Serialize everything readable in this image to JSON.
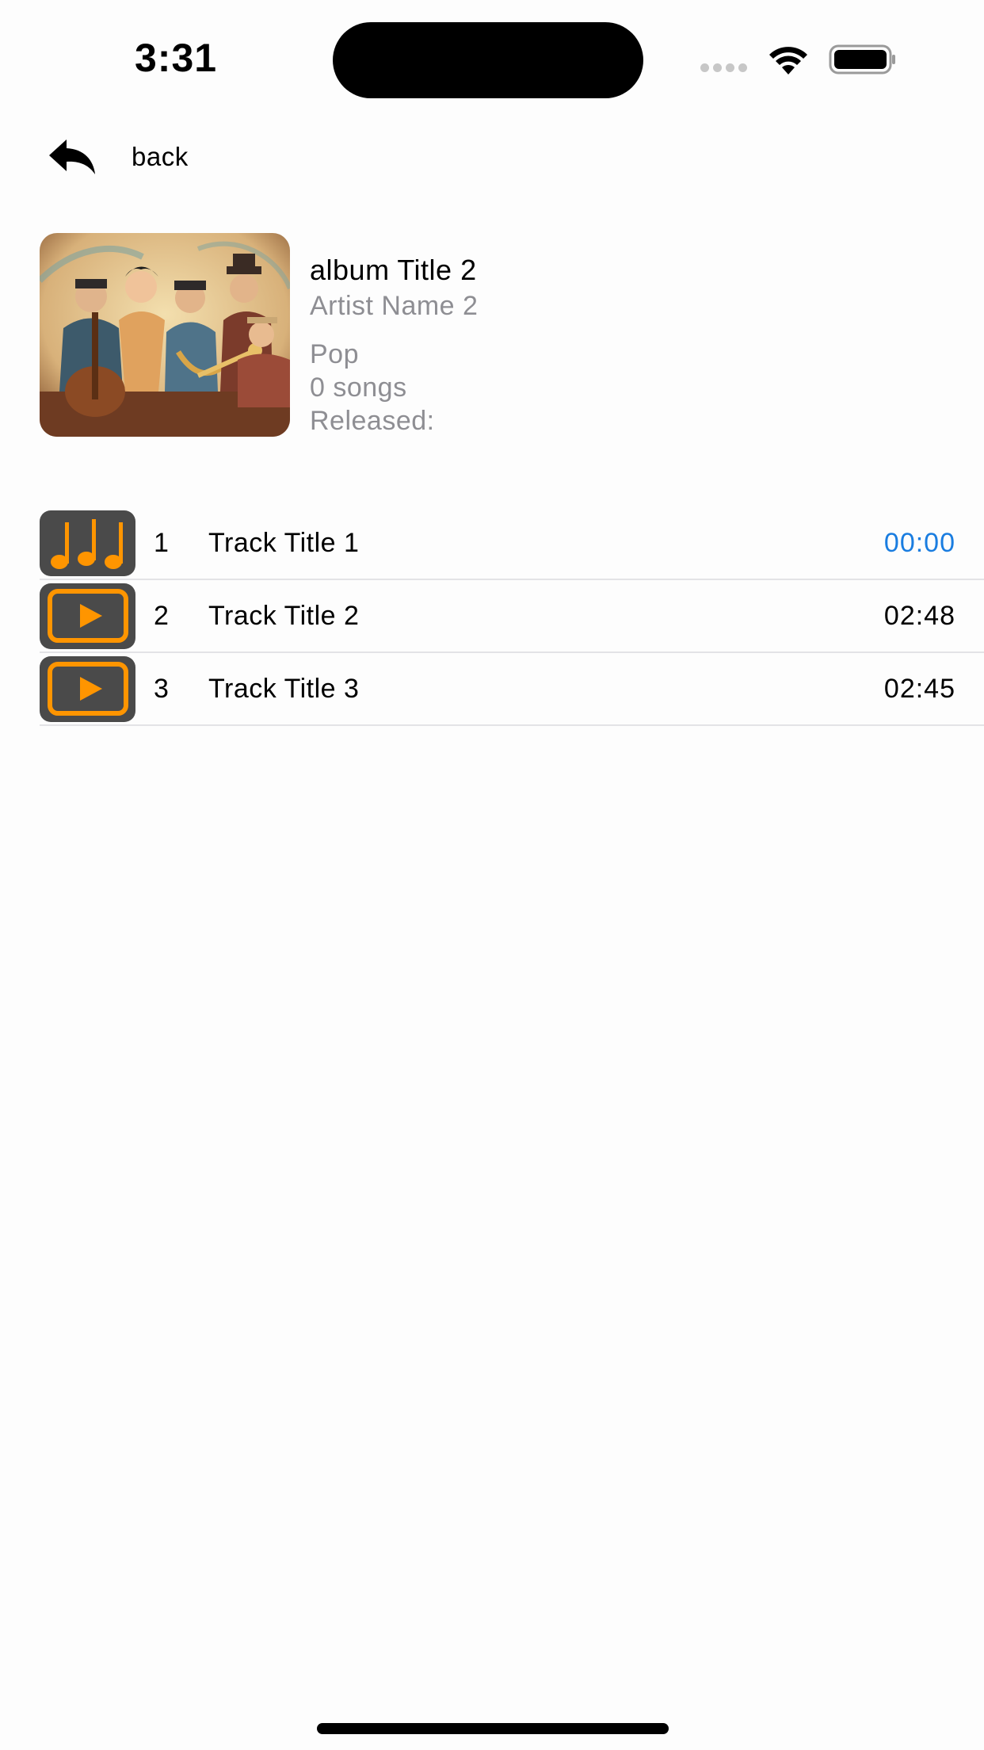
{
  "status_bar": {
    "time": "3:31"
  },
  "nav": {
    "back_label": "back",
    "back_icon": "reply-arrow-icon"
  },
  "album": {
    "title": "album Title 2",
    "artist": "Artist Name 2",
    "genre": "Pop",
    "song_count": "0 songs",
    "released": "Released:",
    "art": "jazz-band-illustration"
  },
  "tracks": [
    {
      "number": "1",
      "title": "Track Title 1",
      "duration": "00:00",
      "icon": "music-notes-icon",
      "active": true
    },
    {
      "number": "2",
      "title": "Track Title 2",
      "duration": "02:48",
      "icon": "play-icon",
      "active": false
    },
    {
      "number": "3",
      "title": "Track Title 3",
      "duration": "02:45",
      "icon": "play-icon",
      "active": false
    }
  ],
  "colors": {
    "accent_orange": "#ff9500",
    "active_blue": "#1a7de0",
    "secondary_text": "#8e8e93",
    "thumb_background": "#4a4a4a"
  }
}
